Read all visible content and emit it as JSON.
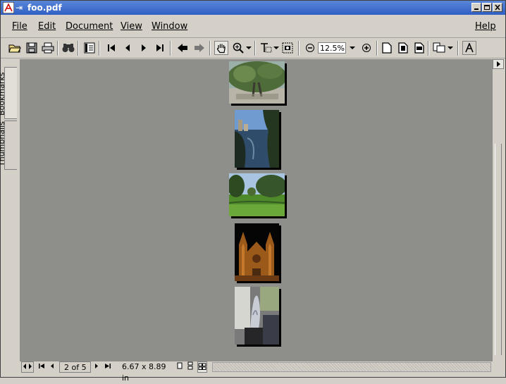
{
  "window": {
    "title": "foo.pdf"
  },
  "menu": {
    "file": "File",
    "edit": "Edit",
    "document": "Document",
    "view": "View",
    "window": "Window",
    "help": "Help"
  },
  "toolbar": {
    "zoom_value": "12.5%"
  },
  "sidebar": {
    "bookmarks": "Bookmarks",
    "thumbnails": "Thumbnails"
  },
  "status": {
    "page": "2 of 5",
    "size": "6.67 x 8.89 in"
  },
  "pages": [
    {
      "name": "page-1",
      "subject": "tree"
    },
    {
      "name": "page-2",
      "subject": "river"
    },
    {
      "name": "page-3",
      "subject": "park"
    },
    {
      "name": "page-4",
      "subject": "cathedral"
    },
    {
      "name": "page-5",
      "subject": "sculpture"
    }
  ]
}
